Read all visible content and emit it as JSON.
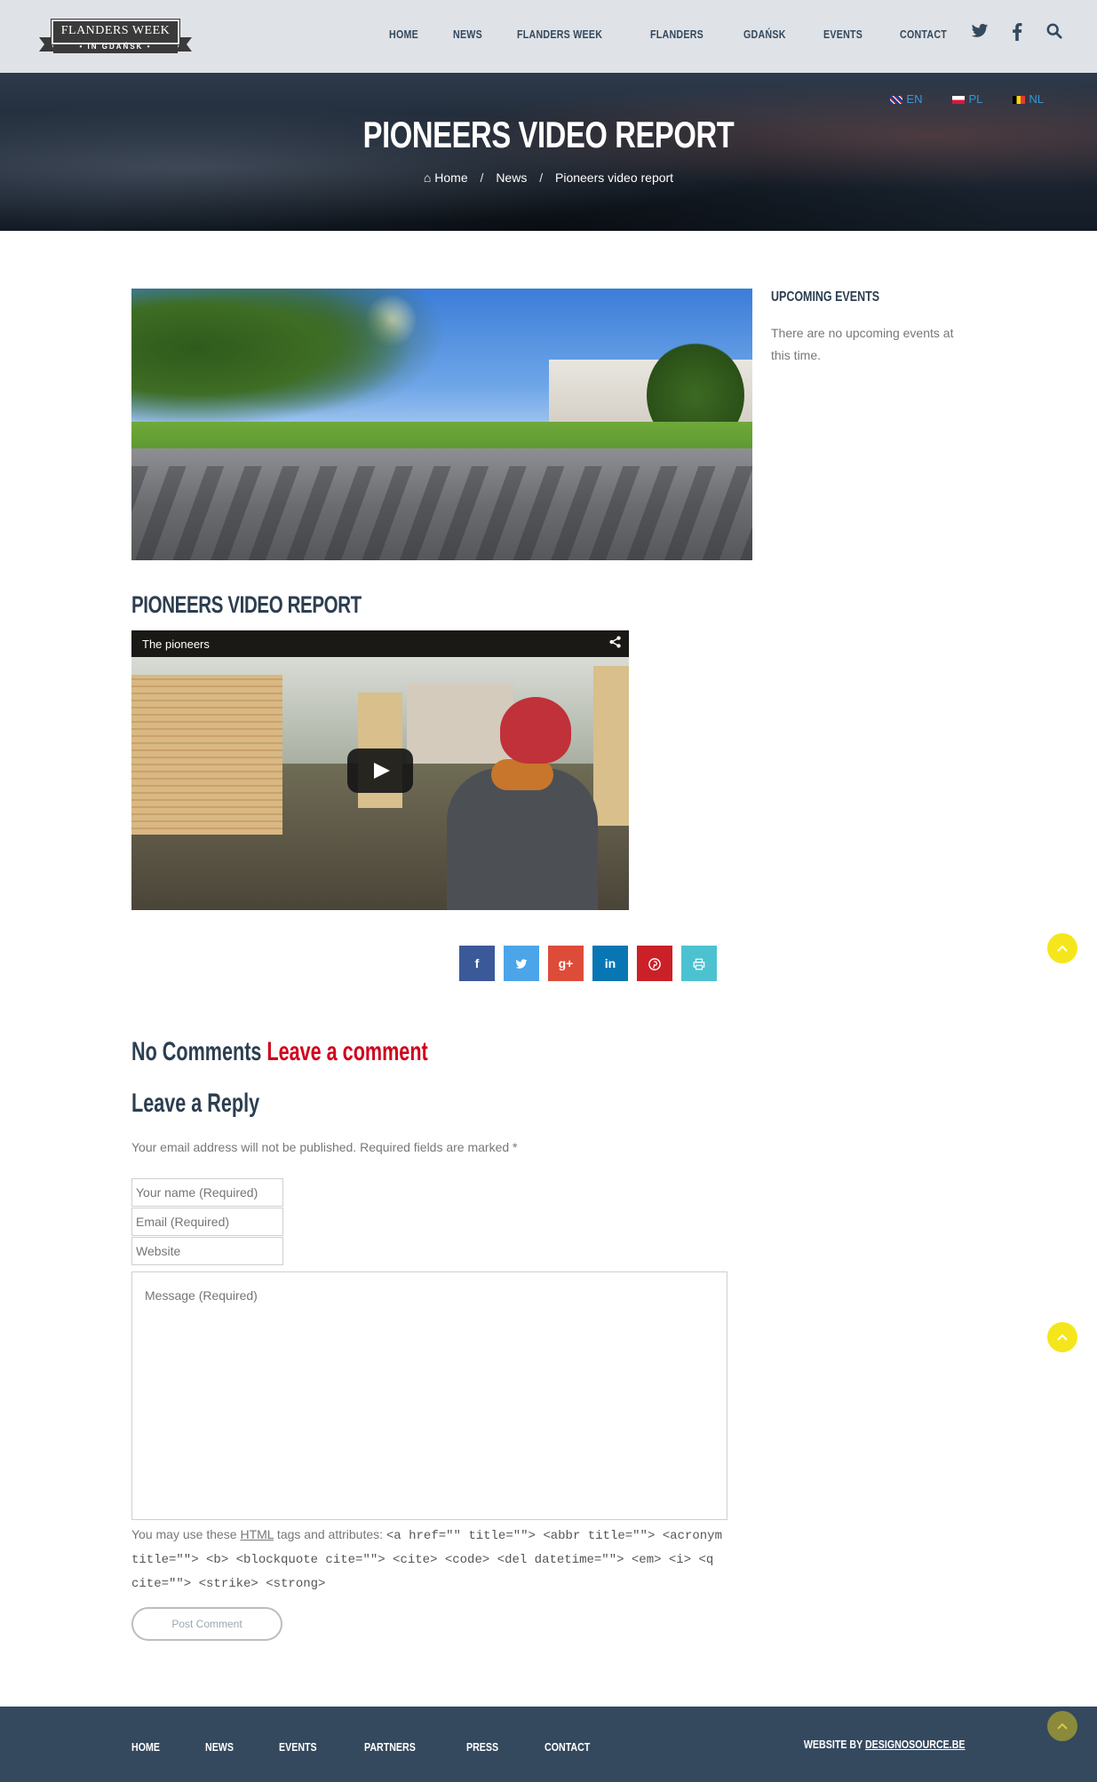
{
  "brand": {
    "title": "FLANDERS WEEK",
    "subtitle": "• IN GDAŃSK •"
  },
  "nav": {
    "items": [
      "HOME",
      "NEWS",
      "FLANDERS WEEK",
      "FLANDERS",
      "GDAŃSK",
      "EVENTS",
      "CONTACT"
    ],
    "icons": [
      "twitter-icon",
      "facebook-icon",
      "search-icon"
    ]
  },
  "languages": [
    {
      "code": "EN",
      "flag": "uk"
    },
    {
      "code": "PL",
      "flag": "pl"
    },
    {
      "code": "NL",
      "flag": "be"
    }
  ],
  "hero": {
    "title": "PIONEERS VIDEO REPORT",
    "breadcrumb": [
      "Home",
      "News",
      "Pioneers video report"
    ]
  },
  "post": {
    "title": "PIONEERS VIDEO REPORT",
    "video": {
      "title": "The pioneers"
    },
    "share_buttons": [
      {
        "name": "facebook",
        "glyph": "f",
        "color": "#3b5998"
      },
      {
        "name": "twitter",
        "glyph": "🐦",
        "color": "#4ca5e8"
      },
      {
        "name": "google-plus",
        "glyph": "g+",
        "color": "#dd4b39"
      },
      {
        "name": "linkedin",
        "glyph": "in",
        "color": "#0976b4"
      },
      {
        "name": "pinterest",
        "glyph": "P",
        "color": "#cb2027"
      },
      {
        "name": "print",
        "glyph": "⎙",
        "color": "#4cc2d1"
      }
    ]
  },
  "comments": {
    "count_label": "No Comments",
    "leave_link": "Leave a comment",
    "reply_title": "Leave a Reply",
    "note": "Your email address will not be published. Required fields are marked *",
    "name_placeholder": "Your name (Required)",
    "email_placeholder": "Email (Required)",
    "website_placeholder": "Website",
    "message_placeholder": "Message (Required)",
    "allowed_prefix": "You may use these ",
    "allowed_abbr": "HTML",
    "allowed_mid": " tags and attributes: ",
    "allowed_code": "<a href=\"\" title=\"\"> <abbr title=\"\"> <acronym title=\"\"> <b> <blockquote cite=\"\"> <cite> <code> <del datetime=\"\"> <em> <i> <q cite=\"\"> <strike> <strong>",
    "submit_label": "Post Comment"
  },
  "sidebar": {
    "title": "UPCOMING EVENTS",
    "text": "There are no upcoming events at this time."
  },
  "footer": {
    "nav": [
      "HOME",
      "NEWS",
      "EVENTS",
      "PARTNERS",
      "PRESS",
      "CONTACT"
    ],
    "credit_prefix": "WEBSITE BY ",
    "credit_link": "DESIGNOSOURCE.BE"
  },
  "colors": {
    "accent_red": "#d0021b",
    "scroll_button": "#f5e61c",
    "footer_bg": "#34495e"
  }
}
